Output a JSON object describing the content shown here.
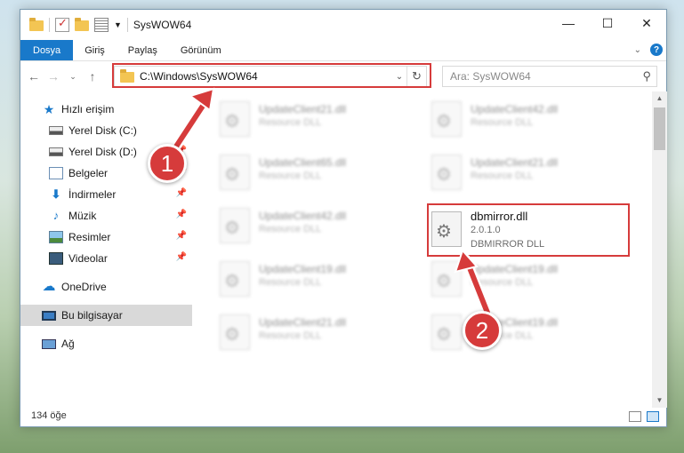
{
  "window": {
    "title": "SysWOW64",
    "controls": {
      "minimize": "—",
      "maximize": "☐",
      "close": "✕"
    }
  },
  "ribbon": {
    "tabs": [
      {
        "label": "Dosya",
        "active": true
      },
      {
        "label": "Giriş"
      },
      {
        "label": "Paylaş"
      },
      {
        "label": "Görünüm"
      }
    ],
    "help": "?"
  },
  "nav": {
    "address": "C:\\Windows\\SysWOW64",
    "search_placeholder": "Ara: SysWOW64"
  },
  "sidebar": {
    "items": [
      {
        "label": "Hızlı erişim",
        "icon": "star-icon"
      },
      {
        "label": "Yerel Disk (C:)",
        "icon": "drive-icon"
      },
      {
        "label": "Yerel Disk (D:)",
        "icon": "drive-icon"
      },
      {
        "label": "Belgeler",
        "icon": "documents-icon"
      },
      {
        "label": "İndirmeler",
        "icon": "download-icon"
      },
      {
        "label": "Müzik",
        "icon": "music-icon"
      },
      {
        "label": "Resimler",
        "icon": "pictures-icon"
      },
      {
        "label": "Videolar",
        "icon": "videos-icon"
      },
      {
        "label": "OneDrive",
        "icon": "cloud-icon"
      },
      {
        "label": "Bu bilgisayar",
        "icon": "computer-icon"
      },
      {
        "label": "Ağ",
        "icon": "network-icon"
      }
    ]
  },
  "files": {
    "left": [
      {
        "name": "UpdateClient21.dll",
        "type": "Resource DLL"
      },
      {
        "name": "UpdateClient65.dll",
        "type": "Resource DLL"
      },
      {
        "name": "UpdateClient42.dll",
        "type": "Resource DLL"
      },
      {
        "name": "UpdateClient19.dll",
        "type": "Resource DLL"
      },
      {
        "name": "UpdateClient21.dll",
        "type": "Resource DLL"
      }
    ],
    "right": [
      {
        "name": "UpdateClient42.dll",
        "type": "Resource DLL"
      },
      {
        "name": "UpdateClient21.dll",
        "type": "Resource DLL"
      },
      {
        "name": "UpdateClient19.dll",
        "type": "Resource DLL"
      },
      {
        "name": "UpdateClient19.dll",
        "type": "Resource DLL"
      }
    ],
    "highlight": {
      "name": "dbmirror.dll",
      "version": "2.0.1.0",
      "description": "DBMIRROR DLL"
    }
  },
  "status": {
    "count": "134 öğe"
  },
  "callouts": [
    "1",
    "2"
  ],
  "colors": {
    "accent": "#1979ca",
    "highlight": "#d63b3b"
  }
}
